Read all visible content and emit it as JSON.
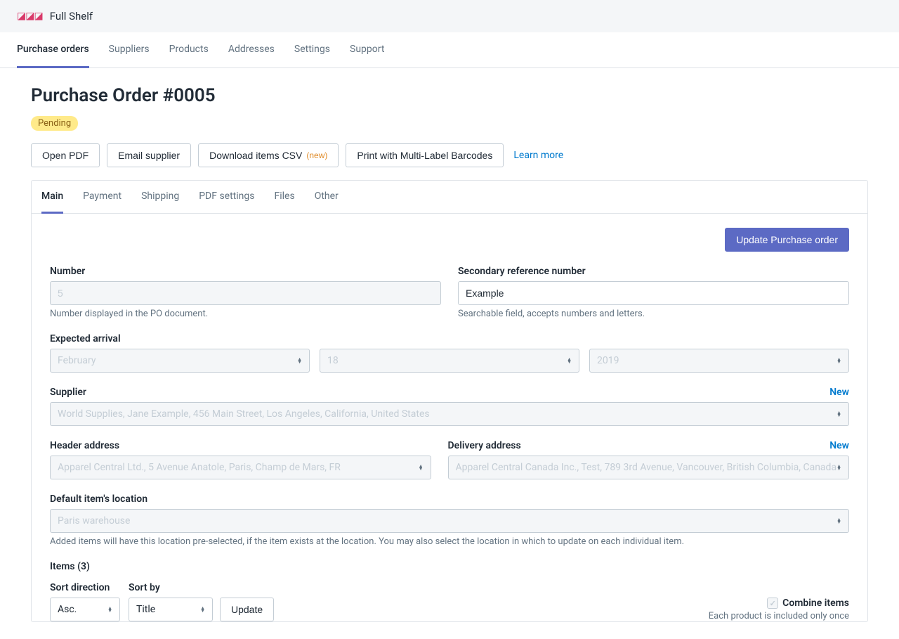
{
  "app": {
    "name": "Full Shelf"
  },
  "nav": {
    "items": [
      {
        "label": "Purchase orders",
        "active": true
      },
      {
        "label": "Suppliers",
        "active": false
      },
      {
        "label": "Products",
        "active": false
      },
      {
        "label": "Addresses",
        "active": false
      },
      {
        "label": "Settings",
        "active": false
      },
      {
        "label": "Support",
        "active": false
      }
    ]
  },
  "page": {
    "title": "Purchase Order #0005",
    "status": "Pending"
  },
  "actions": {
    "open_pdf": "Open PDF",
    "email_supplier": "Email supplier",
    "download_csv": "Download items CSV",
    "download_csv_badge": "(new)",
    "print_barcodes": "Print with Multi-Label Barcodes",
    "learn_more": "Learn more"
  },
  "subtabs": [
    {
      "label": "Main",
      "active": true
    },
    {
      "label": "Payment",
      "active": false
    },
    {
      "label": "Shipping",
      "active": false
    },
    {
      "label": "PDF settings",
      "active": false
    },
    {
      "label": "Files",
      "active": false
    },
    {
      "label": "Other",
      "active": false
    }
  ],
  "form": {
    "update_button": "Update Purchase order",
    "number": {
      "label": "Number",
      "value": "5",
      "help": "Number displayed in the PO document."
    },
    "secondary_ref": {
      "label": "Secondary reference number",
      "value": "Example",
      "help": "Searchable field, accepts numbers and letters."
    },
    "expected_arrival": {
      "label": "Expected arrival",
      "month": "February",
      "day": "18",
      "year": "2019"
    },
    "supplier": {
      "label": "Supplier",
      "new_link": "New",
      "value": "World Supplies, Jane Example, 456 Main Street, Los Angeles, California, United States"
    },
    "header_address": {
      "label": "Header address",
      "value": "Apparel Central Ltd., 5 Avenue Anatole, Paris, Champ de Mars, FR"
    },
    "delivery_address": {
      "label": "Delivery address",
      "new_link": "New",
      "value": "Apparel Central Canada Inc., Test, 789 3rd Avenue, Vancouver, British Columbia, Canada"
    },
    "default_location": {
      "label": "Default item's location",
      "value": "Paris warehouse",
      "help": "Added items will have this location pre-selected, if the item exists at the location. You may also select the location in which to update on each individual item."
    },
    "items": {
      "header": "Items (3)",
      "sort_direction_label": "Sort direction",
      "sort_direction": "Asc.",
      "sort_by_label": "Sort by",
      "sort_by": "Title",
      "update_button": "Update",
      "combine_label": "Combine items",
      "combine_help": "Each product is included only once"
    }
  }
}
